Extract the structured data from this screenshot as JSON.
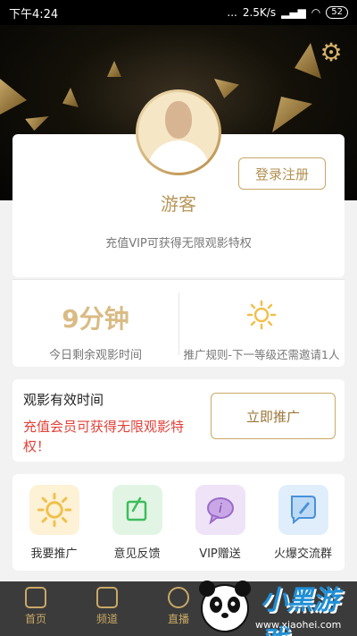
{
  "status_bar": {
    "time": "下午4:24",
    "indicators": "...",
    "network_speed": "2.5K/s",
    "battery": "52"
  },
  "header": {
    "settings_icon": "gear-icon"
  },
  "profile": {
    "login_label": "登录注册",
    "username": "游客",
    "vip_tip": "充值VIP可获得无限观影特权"
  },
  "stats": {
    "remaining_value": "9分钟",
    "remaining_label": "今日剩余观影时间",
    "promo_icon": "sun-icon",
    "promo_rule": "推广规则-下一等级还需邀请1人"
  },
  "validity": {
    "title": "观影有效时间",
    "description": "充值会员可获得无限观影特权！",
    "promote_label": "立即推广"
  },
  "features": [
    {
      "label": "我要推广",
      "icon": "sun-icon",
      "bg": "#fdf1d6"
    },
    {
      "label": "意见反馈",
      "icon": "edit-icon",
      "bg": "#e2f5e4"
    },
    {
      "label": "VIP赠送",
      "icon": "chat-icon",
      "bg": "#eee3f7"
    },
    {
      "label": "火爆交流群",
      "icon": "rocket-icon",
      "bg": "#e0eefb"
    }
  ],
  "tabs": [
    {
      "label": "首页",
      "icon": "home-icon"
    },
    {
      "label": "频道",
      "icon": "play-icon"
    },
    {
      "label": "直播",
      "icon": "compass-icon"
    }
  ],
  "watermark": {
    "text": "小黑游戏",
    "url": "www.xiaohei.com"
  },
  "colors": {
    "gold": "#c9a866",
    "red": "#e0423a",
    "tabbar": "#3b3b3b"
  }
}
